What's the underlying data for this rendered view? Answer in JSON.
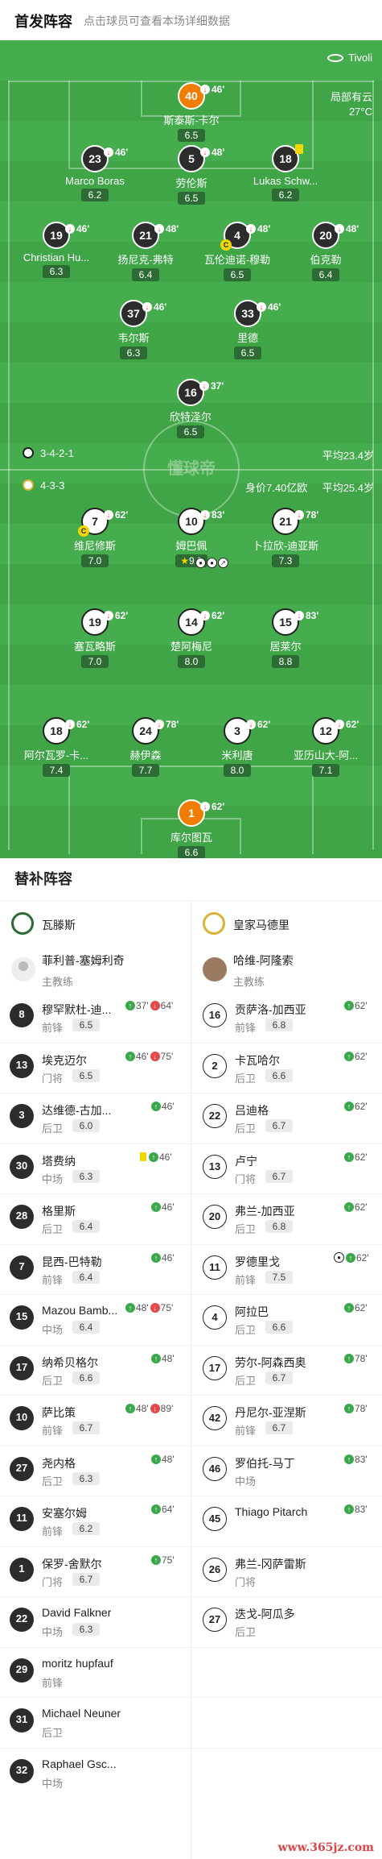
{
  "header": {
    "title": "首发阵容",
    "subtitle": "点击球员可查看本场详细数据"
  },
  "pitch": {
    "venue": "Tivoli",
    "weather": "局部有云",
    "temperature": "27°C",
    "watermark": "懂球帝",
    "home_formation": "3-4-2-1",
    "home_age": "平均23.4岁",
    "away_formation": "4-3-3",
    "away_value": "身价7.40亿欧",
    "away_age": "平均25.4岁",
    "home_players": [
      {
        "num": "40",
        "name": "斯泰斯-卡尔",
        "rating": "6.5",
        "sub": "46'"
      },
      {
        "num": "23",
        "name": "Marco Boras",
        "rating": "6.2",
        "sub": "46'"
      },
      {
        "num": "5",
        "name": "劳伦斯",
        "rating": "6.5",
        "sub": "48'"
      },
      {
        "num": "18",
        "name": "Lukas Schw...",
        "rating": "6.2",
        "sub": ""
      },
      {
        "num": "19",
        "name": "Christian Hu...",
        "rating": "6.3",
        "sub": "46'"
      },
      {
        "num": "21",
        "name": "扬尼克-弗特",
        "rating": "6.4",
        "sub": "48'"
      },
      {
        "num": "4",
        "name": "瓦伦迪诺-穆勒",
        "rating": "6.5",
        "sub": "48'"
      },
      {
        "num": "20",
        "name": "伯克勒",
        "rating": "6.4",
        "sub": "48'"
      },
      {
        "num": "37",
        "name": "韦尔斯",
        "rating": "6.3",
        "sub": "46'"
      },
      {
        "num": "33",
        "name": "里德",
        "rating": "6.5",
        "sub": "46'"
      },
      {
        "num": "16",
        "name": "欣特泽尔",
        "rating": "6.5",
        "sub": "37'"
      }
    ],
    "away_players": [
      {
        "num": "7",
        "name": "维尼修斯",
        "rating": "7.0",
        "sub": "62'"
      },
      {
        "num": "10",
        "name": "姆巴佩",
        "rating": "9.3",
        "sub": "83'"
      },
      {
        "num": "21",
        "name": "卜拉欣-迪亚斯",
        "rating": "7.3",
        "sub": "78'"
      },
      {
        "num": "19",
        "name": "塞瓦略斯",
        "rating": "7.0",
        "sub": "62'"
      },
      {
        "num": "14",
        "name": "楚阿梅尼",
        "rating": "8.0",
        "sub": "62'"
      },
      {
        "num": "15",
        "name": "居莱尔",
        "rating": "8.8",
        "sub": "83'"
      },
      {
        "num": "18",
        "name": "阿尔瓦罗-卡...",
        "rating": "7.4",
        "sub": "62'"
      },
      {
        "num": "24",
        "name": "赫伊森",
        "rating": "7.7",
        "sub": "78'"
      },
      {
        "num": "3",
        "name": "米利唐",
        "rating": "8.0",
        "sub": "62'"
      },
      {
        "num": "12",
        "name": "亚历山大-阿...",
        "rating": "7.1",
        "sub": "62'"
      },
      {
        "num": "1",
        "name": "库尔图瓦",
        "rating": "6.6",
        "sub": "62'"
      }
    ]
  },
  "subs": {
    "title": "替补阵容",
    "home_team": "瓦滕斯",
    "away_team": "皇家马德里",
    "home_coach": {
      "name": "菲利普-塞姆利奇",
      "role": "主教练"
    },
    "away_coach": {
      "name": "哈维-阿隆索",
      "role": "主教练"
    },
    "home": [
      {
        "num": "8",
        "name": "穆罕默杜-迪...",
        "pos": "前锋",
        "rating": "6.5",
        "in": "37'",
        "out": "64'"
      },
      {
        "num": "13",
        "name": "埃克迈尔",
        "pos": "门将",
        "rating": "6.5",
        "in": "46'",
        "out": "75'"
      },
      {
        "num": "3",
        "name": "达维德-古加...",
        "pos": "后卫",
        "rating": "6.0",
        "in": "46'",
        "out": ""
      },
      {
        "num": "30",
        "name": "塔费纳",
        "pos": "中场",
        "rating": "6.3",
        "in": "46'",
        "out": "",
        "card": true
      },
      {
        "num": "28",
        "name": "格里斯",
        "pos": "后卫",
        "rating": "6.4",
        "in": "46'",
        "out": ""
      },
      {
        "num": "7",
        "name": "昆西-巴特勒",
        "pos": "前锋",
        "rating": "6.4",
        "in": "46'",
        "out": ""
      },
      {
        "num": "15",
        "name": "Mazou Bamb...",
        "pos": "中场",
        "rating": "6.4",
        "in": "48'",
        "out": "75'"
      },
      {
        "num": "17",
        "name": "纳希贝格尔",
        "pos": "后卫",
        "rating": "6.6",
        "in": "48'",
        "out": ""
      },
      {
        "num": "10",
        "name": "萨比策",
        "pos": "前锋",
        "rating": "6.7",
        "in": "48'",
        "out": "89'"
      },
      {
        "num": "27",
        "name": "尧内格",
        "pos": "后卫",
        "rating": "6.3",
        "in": "48'",
        "out": ""
      },
      {
        "num": "11",
        "name": "安塞尔姆",
        "pos": "前锋",
        "rating": "6.2",
        "in": "64'",
        "out": ""
      },
      {
        "num": "1",
        "name": "保罗-舍默尔",
        "pos": "门将",
        "rating": "6.7",
        "in": "75'",
        "out": ""
      },
      {
        "num": "22",
        "name": "David Falkner",
        "pos": "中场",
        "rating": "6.3",
        "in": "",
        "out": ""
      },
      {
        "num": "29",
        "name": "moritz hupfauf",
        "pos": "前锋",
        "rating": "",
        "in": "",
        "out": ""
      },
      {
        "num": "31",
        "name": "Michael Neuner",
        "pos": "后卫",
        "rating": "",
        "in": "",
        "out": ""
      },
      {
        "num": "32",
        "name": "Raphael Gsc...",
        "pos": "中场",
        "rating": "",
        "in": "",
        "out": ""
      }
    ],
    "away": [
      {
        "num": "16",
        "name": "贡萨洛-加西亚",
        "pos": "前锋",
        "rating": "6.8",
        "in": "62'",
        "goal": false
      },
      {
        "num": "2",
        "name": "卡瓦哈尔",
        "pos": "后卫",
        "rating": "6.6",
        "in": "62'",
        "goal": false
      },
      {
        "num": "22",
        "name": "吕迪格",
        "pos": "后卫",
        "rating": "6.7",
        "in": "62'",
        "goal": false
      },
      {
        "num": "13",
        "name": "卢宁",
        "pos": "门将",
        "rating": "6.7",
        "in": "62'",
        "goal": false
      },
      {
        "num": "20",
        "name": "弗兰-加西亚",
        "pos": "后卫",
        "rating": "6.8",
        "in": "62'",
        "goal": false
      },
      {
        "num": "11",
        "name": "罗德里戈",
        "pos": "前锋",
        "rating": "7.5",
        "in": "62'",
        "goal": true
      },
      {
        "num": "4",
        "name": "阿拉巴",
        "pos": "后卫",
        "rating": "6.6",
        "in": "62'",
        "goal": false
      },
      {
        "num": "17",
        "name": "劳尔-阿森西奥",
        "pos": "后卫",
        "rating": "6.7",
        "in": "78'",
        "goal": false
      },
      {
        "num": "42",
        "name": "丹尼尔-亚涅斯",
        "pos": "前锋",
        "rating": "6.7",
        "in": "78'",
        "goal": false
      },
      {
        "num": "46",
        "name": "罗伯托-马丁",
        "pos": "中场",
        "rating": "",
        "in": "83'",
        "goal": false
      },
      {
        "num": "45",
        "name": "Thiago Pitarch",
        "pos": "",
        "rating": "",
        "in": "83'",
        "goal": false
      },
      {
        "num": "26",
        "name": "弗兰-冈萨雷斯",
        "pos": "门将",
        "rating": "",
        "in": "",
        "goal": false
      },
      {
        "num": "27",
        "name": "迭戈-阿瓜多",
        "pos": "后卫",
        "rating": "",
        "in": "",
        "goal": false
      }
    ]
  },
  "watermark": "www.365jz.com"
}
